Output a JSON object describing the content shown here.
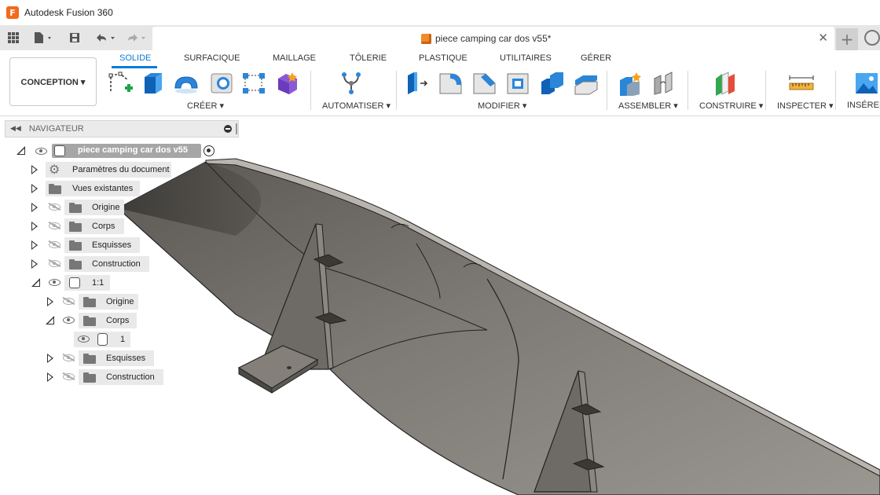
{
  "window": {
    "app_title": "Autodesk Fusion 360",
    "logo_letter": "F"
  },
  "document_tab": {
    "title": "piece camping car dos v55*"
  },
  "ribbon": {
    "workspace": "CONCEPTION ▾",
    "tabs": [
      "SOLIDE",
      "SURFACIQUE",
      "MAILLAGE",
      "TÔLERIE",
      "PLASTIQUE",
      "UTILITAIRES",
      "GÉRER"
    ],
    "groups": [
      "CRÉER ▾",
      "AUTOMATISER ▾",
      "MODIFIER ▾",
      "ASSEMBLER ▾",
      "CONSTRUIRE ▾",
      "INSPECTER ▾",
      "INSÉRER"
    ]
  },
  "navigator": {
    "title": "NAVIGATEUR",
    "root": "piece camping car dos v55",
    "items": [
      "Paramètres du document",
      "Vues existantes",
      "Origine",
      "Corps",
      "Esquisses",
      "Construction",
      "1:1",
      "Origine",
      "Corps",
      "1",
      "Esquisses",
      "Construction"
    ]
  },
  "colors": {
    "accent": "#0a7bd5",
    "logo": "#f26a1b",
    "model": "#6f6b66"
  }
}
